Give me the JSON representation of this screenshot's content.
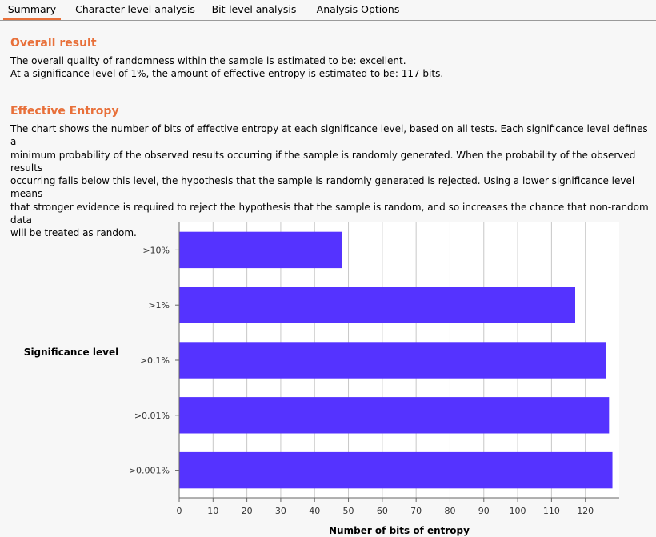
{
  "tabs": [
    {
      "label": "Summary",
      "active": true
    },
    {
      "label": "Character-level analysis",
      "active": false
    },
    {
      "label": "Bit-level analysis",
      "active": false
    },
    {
      "label": "Analysis Options",
      "active": false
    }
  ],
  "overall": {
    "title": "Overall result",
    "line1": "The overall quality of randomness within the sample is estimated to be: excellent.",
    "line2": "At a significance level of 1%, the amount of effective entropy is estimated to be: 117 bits."
  },
  "entropy": {
    "title": "Effective Entropy",
    "lines": [
      "The chart shows the number of bits of effective entropy at each significance level, based on all tests. Each significance level defines a",
      "minimum probability of the observed results occurring if the sample is randomly generated. When the probability of the observed results",
      "occurring falls below this level, the hypothesis that the sample is randomly generated is rejected. Using a lower significance level means",
      "that stronger evidence is required to reject the hypothesis that the sample is random, and so increases the chance that non-random data",
      "will be treated as random."
    ]
  },
  "colors": {
    "accent": "#e8703a",
    "bar": "#5533ff"
  },
  "chart_data": {
    "type": "bar",
    "orientation": "horizontal",
    "categories": [
      ">10%",
      ">1%",
      ">0.1%",
      ">0.01%",
      ">0.001%"
    ],
    "values": [
      48,
      117,
      126,
      127,
      128
    ],
    "xlabel": "Number of bits of entropy",
    "ylabel": "Significance level",
    "xlim": [
      0,
      130
    ],
    "xticks": [
      0,
      10,
      20,
      30,
      40,
      50,
      60,
      70,
      80,
      90,
      100,
      110,
      120
    ],
    "grid": true
  }
}
